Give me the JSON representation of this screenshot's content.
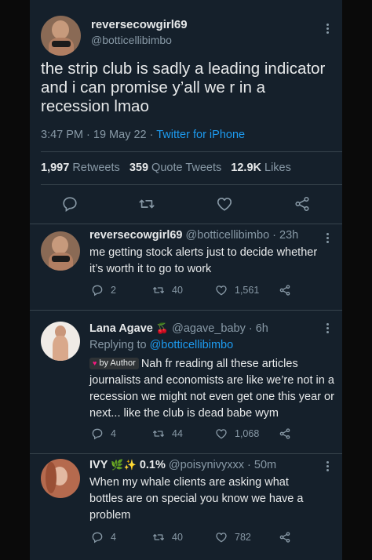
{
  "main_tweet": {
    "display_name": "reversecowgirl69",
    "handle": "@botticellibimbo",
    "text": "the strip club is sadly a leading indicator and i can promise y’all we r in a recession lmao",
    "time": "3:47 PM",
    "date": "19 May 22",
    "source": "Twitter for iPhone",
    "retweets_count": "1,997",
    "retweets_label": "Retweets",
    "quotes_count": "359",
    "quotes_label": "Quote Tweets",
    "likes_count": "12.9K",
    "likes_label": "Likes"
  },
  "replies": [
    {
      "display_name": "reversecowgirl69",
      "handle": "@botticellibimbo",
      "time": "23h",
      "text": "me getting stock alerts just to decide whether it’s worth it to go to work",
      "reply_count": "2",
      "retweet_count": "40",
      "like_count": "1,561"
    },
    {
      "display_name": "Lana Agave",
      "name_emoji": "🍒",
      "handle": "@agave_baby",
      "time": "6h",
      "replying_prefix": "Replying to",
      "replying_to": "@botticellibimbo",
      "badge": "by Author",
      "text": "Nah fr reading all these articles journalists and economists are like we’re not in a recession we might not even get one this year or next... like the club is dead babe wym",
      "reply_count": "4",
      "retweet_count": "44",
      "like_count": "1,068"
    },
    {
      "display_name": "IVY",
      "name_emoji": "🌿✨",
      "name_suffix": "0.1%",
      "handle": "@poisynivyxxx",
      "time": "50m",
      "text": "When my whale clients are asking what bottles are on special you know we have a problem",
      "reply_count": "4",
      "retweet_count": "40",
      "like_count": "782"
    }
  ],
  "colors": {
    "background": "#15202b",
    "text": "#e7e9ea",
    "secondary": "#8899a6",
    "accent": "#1d9bf0",
    "divider": "#38444d"
  },
  "icons": [
    "reply-icon",
    "retweet-icon",
    "like-icon",
    "share-icon",
    "more-icon"
  ]
}
